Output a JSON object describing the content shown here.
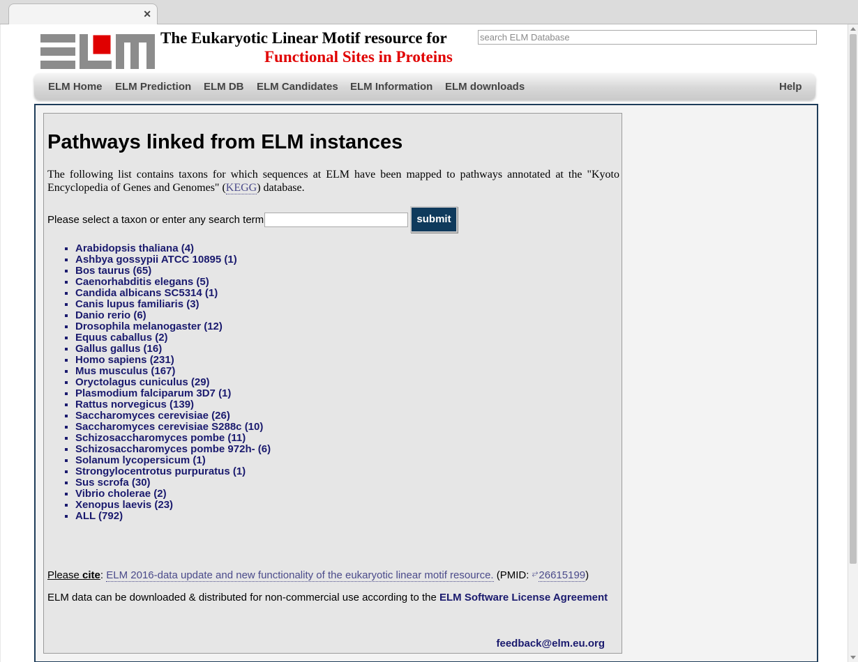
{
  "header": {
    "logo_text": "ELM",
    "title_line1": "The Eukaryotic Linear Motif resource for",
    "title_line2": "Functional Sites in Proteins",
    "search_placeholder": "search ELM Database"
  },
  "nav": {
    "items": [
      "ELM Home",
      "ELM Prediction",
      "ELM DB",
      "ELM Candidates",
      "ELM Information",
      "ELM downloads"
    ],
    "help": "Help"
  },
  "main": {
    "heading": "Pathways linked from ELM instances",
    "intro_before": "The following list contains taxons for which sequences at ELM have been mapped to pathways annotated at the \"Kyoto Encyclopedia of Genes and Genomes\" (",
    "intro_link": "KEGG",
    "intro_after": ") database.",
    "form_label": "Please select a taxon or enter any search term:",
    "input_value": "",
    "submit_label": "submit",
    "taxa": [
      "Arabidopsis thaliana (4)",
      "Ashbya gossypii ATCC 10895 (1)",
      "Bos taurus (65)",
      "Caenorhabditis elegans (5)",
      "Candida albicans SC5314 (1)",
      "Canis lupus familiaris (3)",
      "Danio rerio (6)",
      "Drosophila melanogaster (12)",
      "Equus caballus (2)",
      "Gallus gallus (16)",
      "Homo sapiens (231)",
      "Mus musculus (167)",
      "Oryctolagus cuniculus (29)",
      "Plasmodium falciparum 3D7 (1)",
      "Rattus norvegicus (139)",
      "Saccharomyces cerevisiae (26)",
      "Saccharomyces cerevisiae S288c (10)",
      "Schizosaccharomyces pombe (11)",
      "Schizosaccharomyces pombe 972h- (6)",
      "Solanum lycopersicum (1)",
      "Strongylocentrotus purpuratus (1)",
      "Sus scrofa (30)",
      "Vibrio cholerae (2)",
      "Xenopus laevis (23)",
      "ALL (792)"
    ],
    "cite_please": "Please ",
    "cite_word": "cite",
    "cite_colon": ": ",
    "cite_link": "ELM 2016-data update and new functionality of the eukaryotic linear motif resource.",
    "cite_pmid_prefix": " (PMID: ",
    "cite_pmid": "26615199",
    "cite_pmid_suffix": ")",
    "license_text": "ELM data can be downloaded & distributed for non-commercial use according to the ",
    "license_link": "ELM Software License Agreement",
    "feedback": "feedback@elm.eu.org"
  },
  "colors": {
    "title_red": "#e00000",
    "link_navy": "#1a1a6e",
    "submit_bg": "#0f3a5c",
    "frame_border": "#1f3d5a"
  }
}
